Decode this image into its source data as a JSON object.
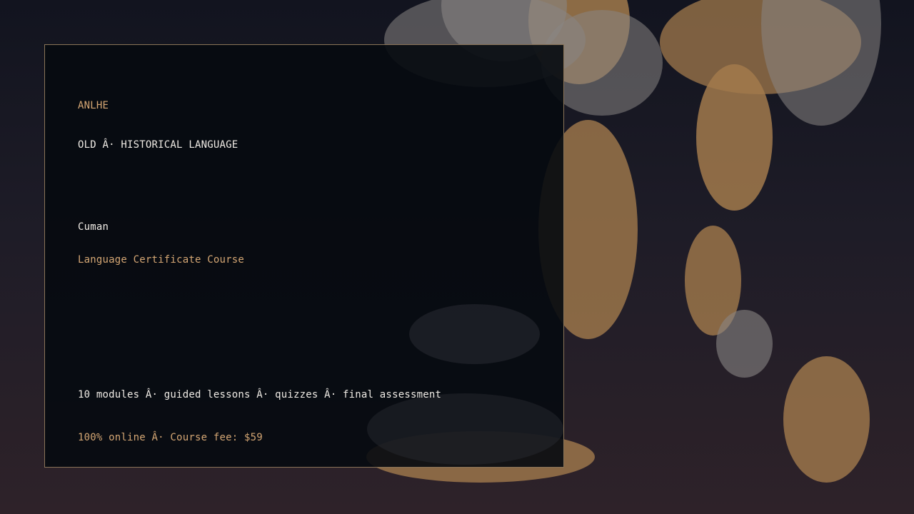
{
  "brand": "ANLHE",
  "category": "OLD Â· HISTORICAL LANGUAGE",
  "course": {
    "title": "Cuman",
    "subtitle": "Language Certificate Course"
  },
  "details": {
    "features": "10 modules Â· guided lessons Â· quizzes Â· final assessment",
    "pricing": "100% online Â· Course fee: $59"
  },
  "colors": {
    "accent": "#d5a774",
    "border": "#8a7458",
    "panel": "#060a10",
    "text": "#f0ece6"
  }
}
